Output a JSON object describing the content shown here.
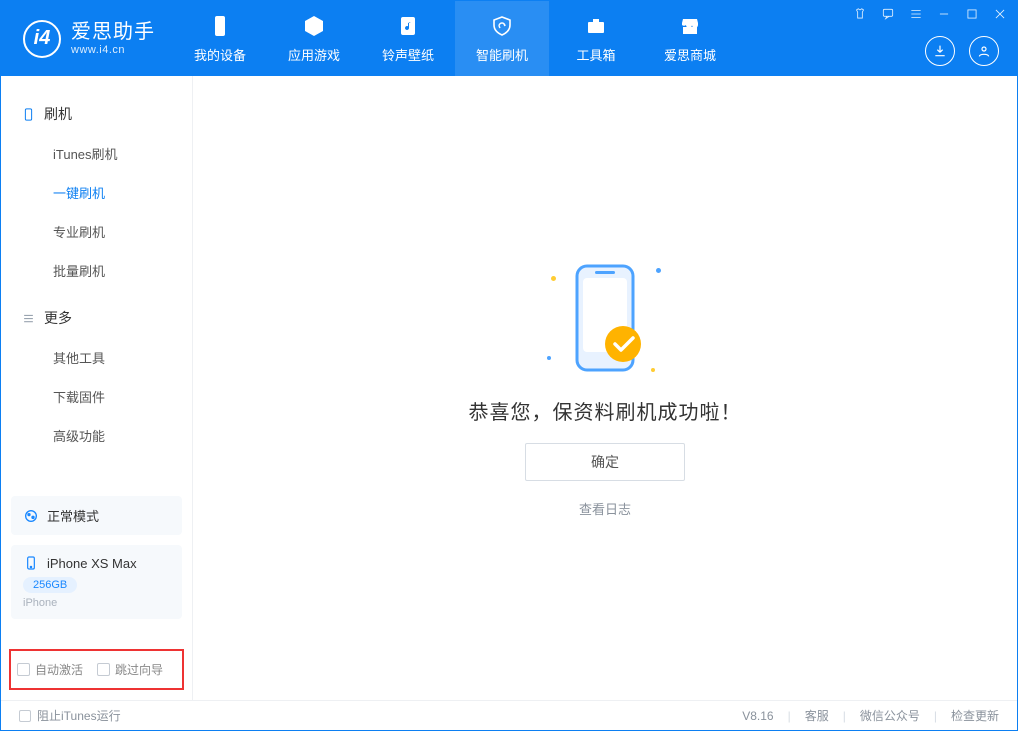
{
  "app": {
    "title": "爱思助手",
    "subtitle": "www.i4.cn"
  },
  "nav": {
    "items": [
      {
        "label": "我的设备"
      },
      {
        "label": "应用游戏"
      },
      {
        "label": "铃声壁纸"
      },
      {
        "label": "智能刷机"
      },
      {
        "label": "工具箱"
      },
      {
        "label": "爱思商城"
      }
    ]
  },
  "sidebar": {
    "group1": {
      "title": "刷机",
      "items": [
        "iTunes刷机",
        "一键刷机",
        "专业刷机",
        "批量刷机"
      ]
    },
    "group2": {
      "title": "更多",
      "items": [
        "其他工具",
        "下载固件",
        "高级功能"
      ]
    },
    "mode_card": {
      "label": "正常模式"
    },
    "device_card": {
      "name": "iPhone XS Max",
      "capacity": "256GB",
      "type": "iPhone"
    },
    "checkbox1": "自动激活",
    "checkbox2": "跳过向导"
  },
  "main": {
    "success_text": "恭喜您，保资料刷机成功啦！",
    "ok_button": "确定",
    "view_log": "查看日志"
  },
  "footer": {
    "block_itunes": "阻止iTunes运行",
    "version": "V8.16",
    "link1": "客服",
    "link2": "微信公众号",
    "link3": "检查更新"
  }
}
